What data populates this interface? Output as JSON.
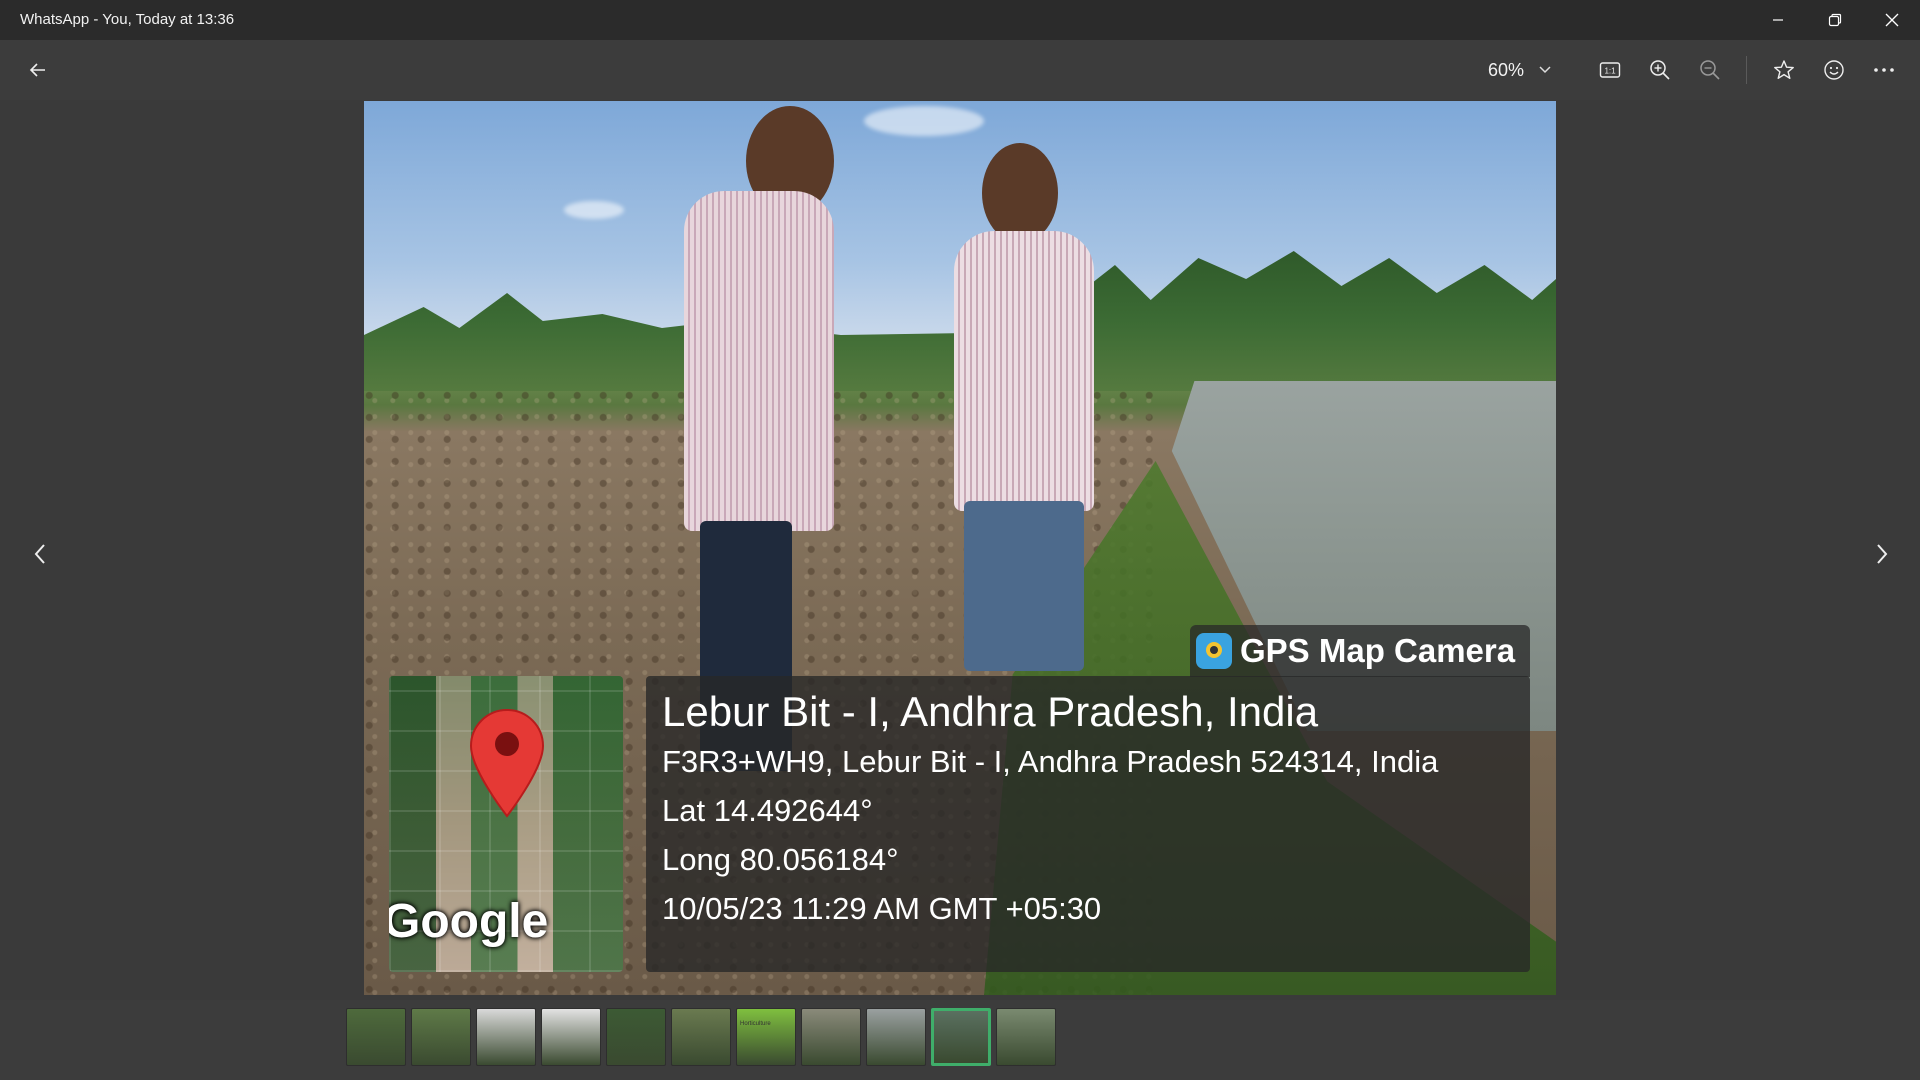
{
  "window": {
    "title": "WhatsApp - You, Today at 13:36",
    "controls": {
      "minimize": "minimize-icon",
      "restore": "restore-icon",
      "close": "close-icon"
    }
  },
  "toolbar": {
    "back_icon": "back-arrow-icon",
    "zoom_level": "60%",
    "zoom_dropdown_icon": "chevron-down-icon",
    "actions": [
      "actual-size-icon",
      "zoom-in-icon",
      "zoom-out-icon",
      "star-icon",
      "emoji-icon",
      "more-icon"
    ]
  },
  "viewer": {
    "prev_icon": "chevron-left-icon",
    "next_icon": "chevron-right-icon"
  },
  "overlay": {
    "brand": "GPS Map Camera",
    "map_logo": "Google",
    "location_title": "Lebur Bit - I, Andhra Pradesh, India",
    "address": "F3R3+WH9, Lebur Bit - I, Andhra Pradesh 524314, India",
    "latitude": "Lat 14.492644°",
    "longitude": "Long 80.056184°",
    "timestamp": "10/05/23 11:29 AM GMT +05:30"
  },
  "filmstrip": {
    "count": 11,
    "selected_index": 9,
    "thumb_colors": [
      "#4e6a3c",
      "#5f7a48",
      "#d9d9d9",
      "#e2e2e2",
      "#3c5a34",
      "#6a7a50",
      "#7fbf3f",
      "#8a8a7a",
      "#9aa0a0",
      "#5a7060",
      "#7a8a70"
    ],
    "thumb_labels": [
      "",
      "",
      "",
      "",
      "",
      "",
      "Horticulture",
      "",
      "",
      "",
      ""
    ]
  },
  "colors": {
    "titlebar_bg": "#2b2b2b",
    "stage_bg": "#3a3a3a",
    "selection_accent": "#3fae6a",
    "pin_red": "#e53935"
  }
}
